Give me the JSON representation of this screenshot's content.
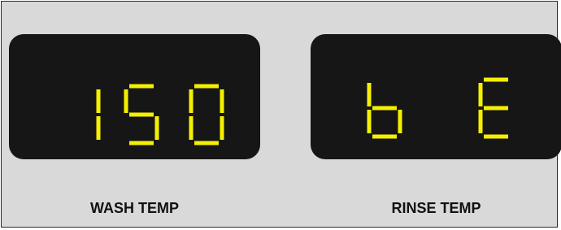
{
  "segment_color": "#f5f000",
  "displays": [
    {
      "id": "wash",
      "value": "150",
      "label": "WASH TEMP"
    },
    {
      "id": "rinse",
      "value": "bE",
      "label": "RINSE TEMP"
    }
  ]
}
